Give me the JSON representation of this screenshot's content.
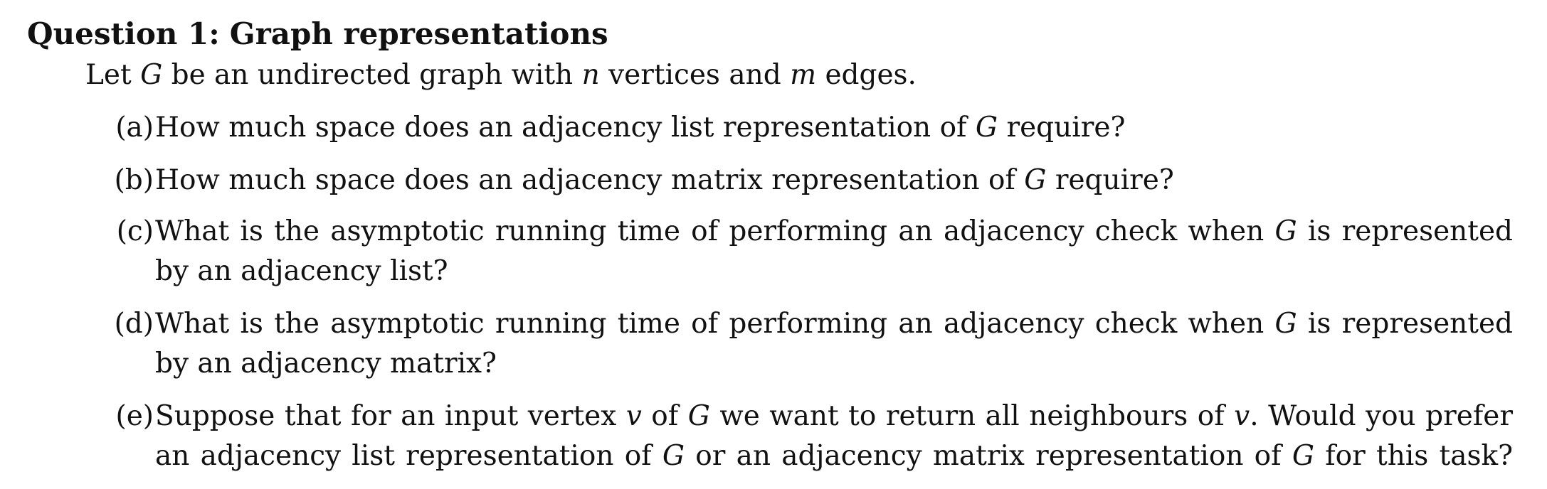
{
  "question": {
    "title_prefix": "Question 1:",
    "title_text": "Graph representations",
    "intro": {
      "t1": "Let ",
      "G": "G",
      "t2": " be an undirected graph with ",
      "n": "n",
      "t3": " vertices and ",
      "m": "m",
      "t4": " edges."
    },
    "parts": {
      "a": {
        "label": "(a)",
        "t1": "How much space does an adjacency list representation of ",
        "G": "G",
        "t2": " require?"
      },
      "b": {
        "label": "(b)",
        "t1": "How much space does an adjacency matrix representation of ",
        "G": "G",
        "t2": " require?"
      },
      "c": {
        "label": "(c)",
        "t1": "What is the asymptotic running time of performing an adjacency check when ",
        "G": "G",
        "t2": " is represented",
        "line2": "by an adjacency list?"
      },
      "d": {
        "label": "(d)",
        "t1": "What is the asymptotic running time of performing an adjacency check when ",
        "G": "G",
        "t2": " is represented",
        "line2": "by an adjacency matrix?"
      },
      "e": {
        "label": "(e)",
        "t1": "Suppose that for an input vertex ",
        "v1": "v",
        "t2": " of ",
        "G1": "G",
        "t3": " we want to return all neighbours of ",
        "v2": "v",
        "t4": ". Would you prefer",
        "l2_t1": "an adjacency list representation of ",
        "G2": "G",
        "l2_t2": " or an adjacency matrix representation of ",
        "G3": "G",
        "l2_t3": " for this task?"
      }
    }
  }
}
